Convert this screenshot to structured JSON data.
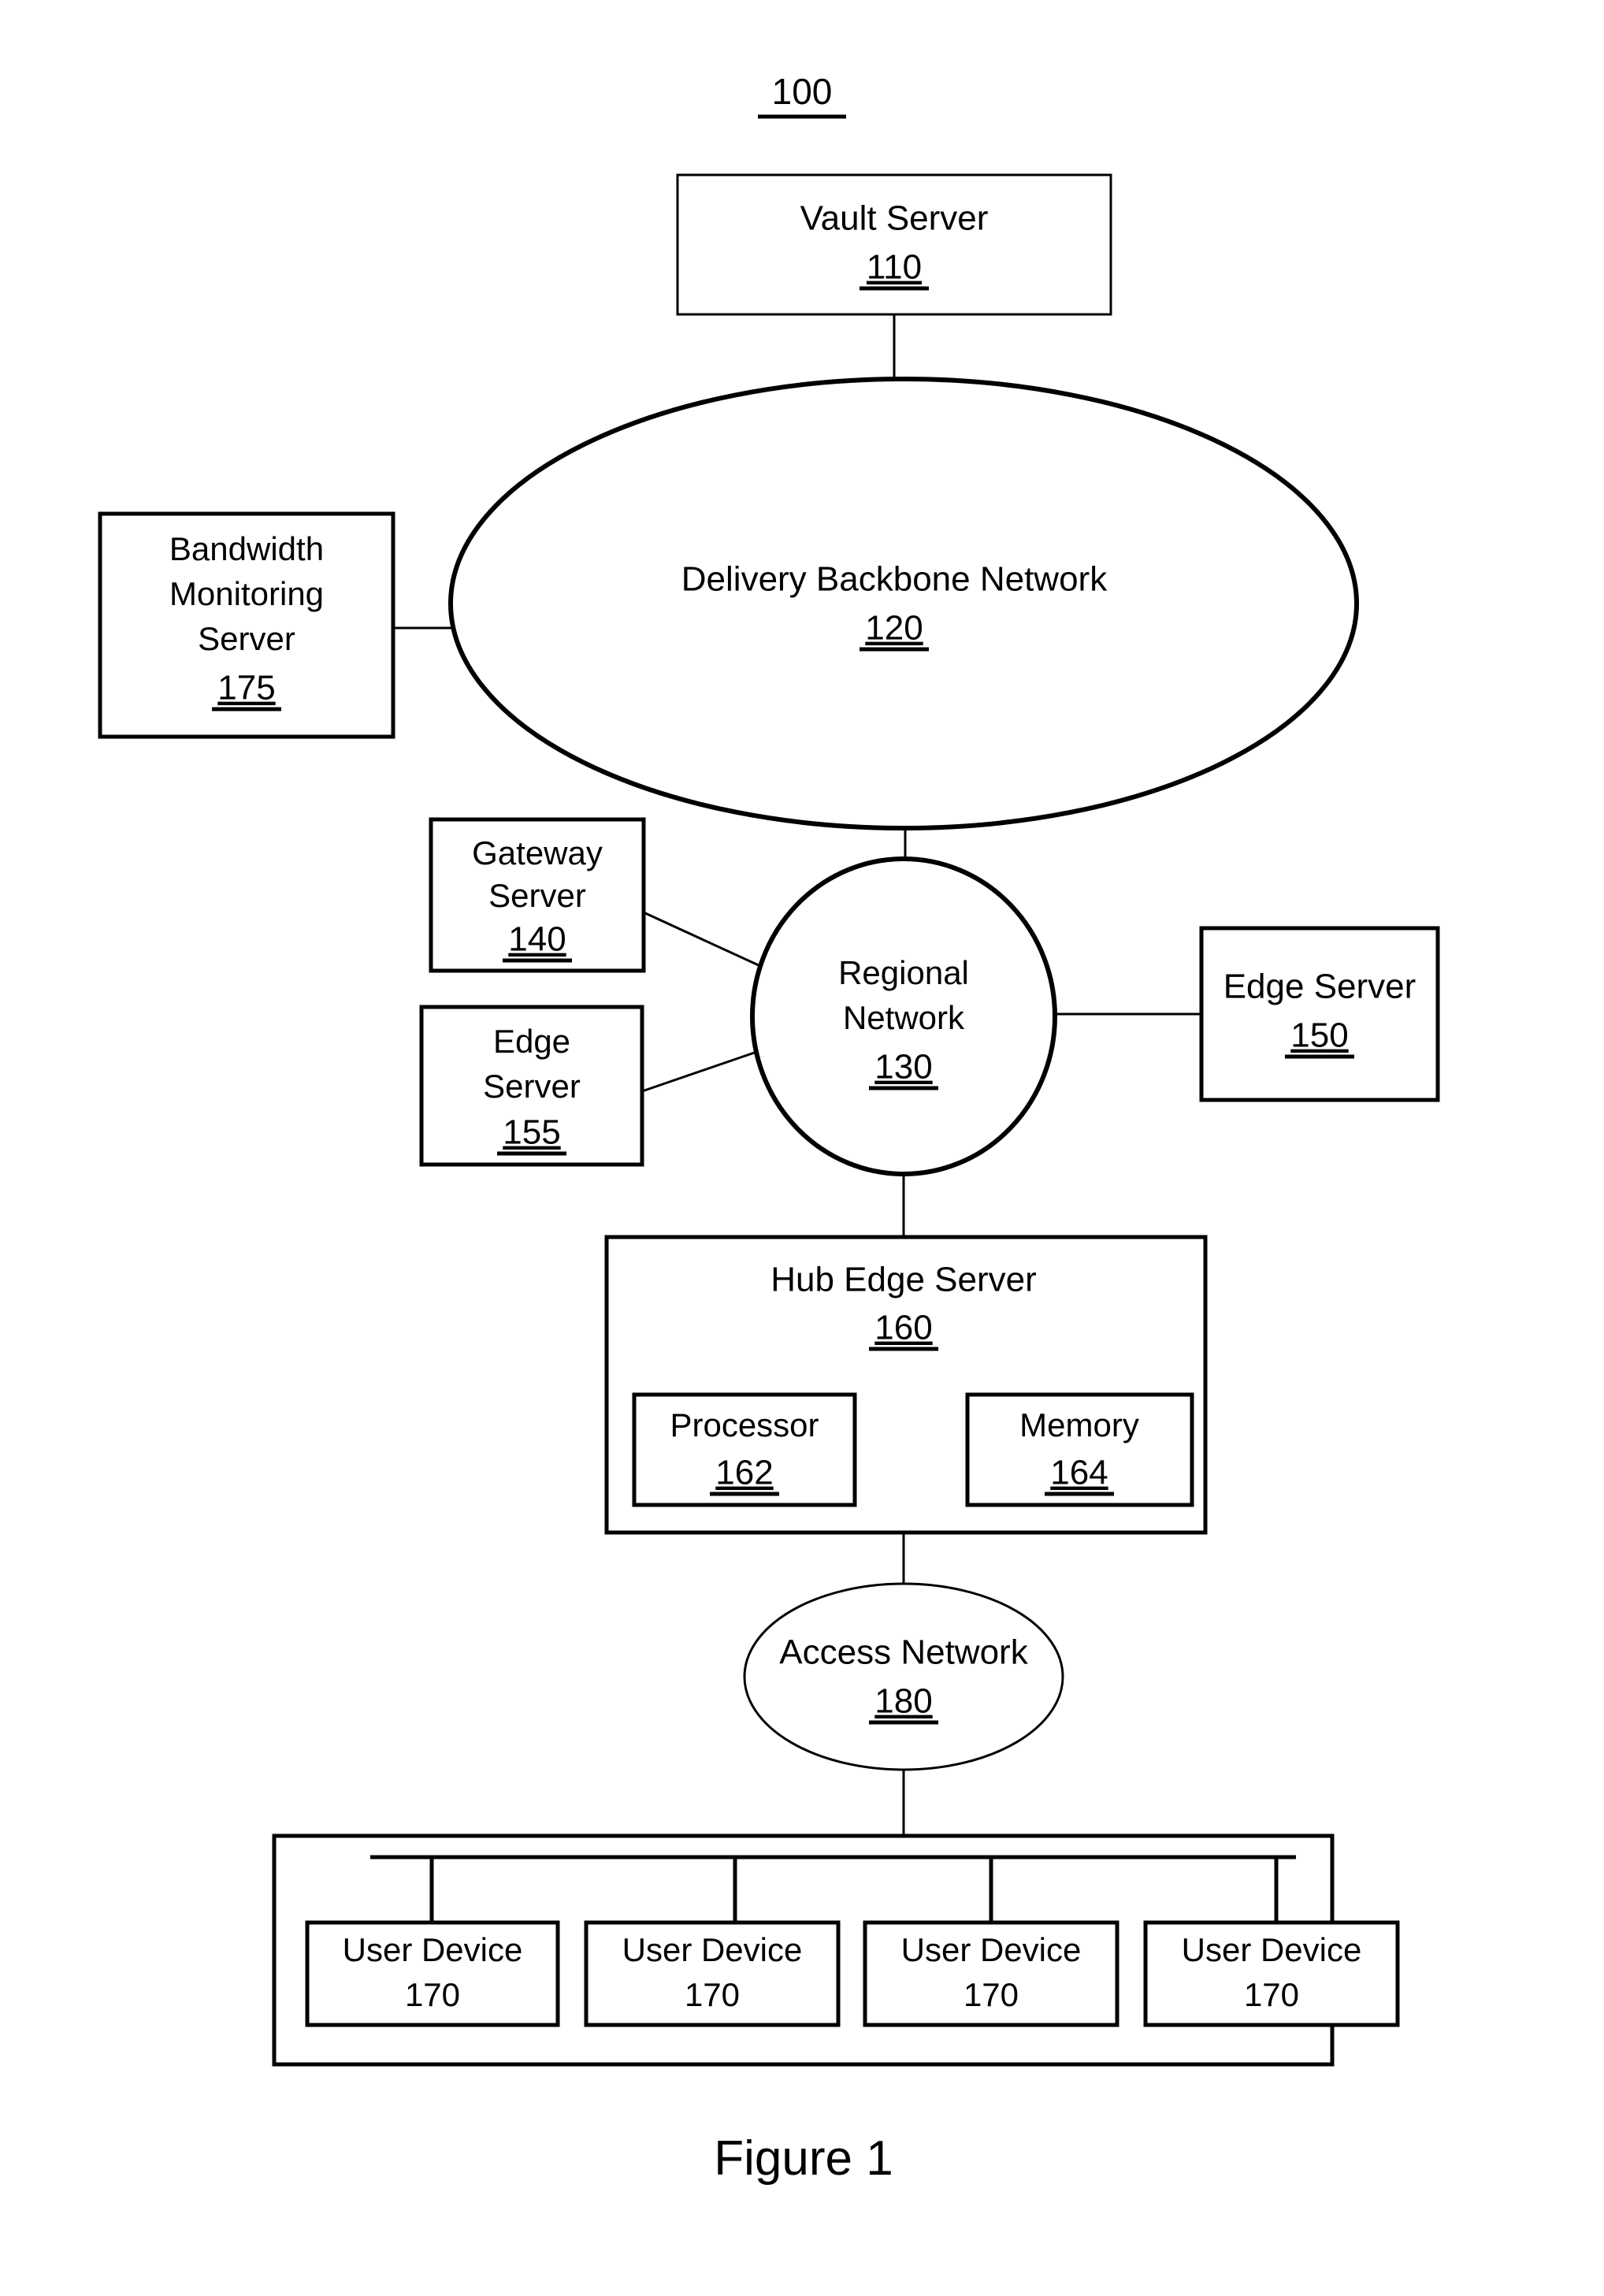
{
  "figure": {
    "system_ref": "100",
    "caption": "Figure 1"
  },
  "nodes": {
    "vault_server": {
      "label": "Vault Server",
      "ref": "110"
    },
    "backbone": {
      "label": "Delivery Backbone Network",
      "ref": "120"
    },
    "bandwidth": {
      "label_line1": "Bandwidth",
      "label_line2": "Monitoring",
      "label_line3": "Server",
      "ref": "175"
    },
    "gateway": {
      "label_line1": "Gateway",
      "label_line2": "Server",
      "ref": "140"
    },
    "edge_155": {
      "label_line1": "Edge",
      "label_line2": "Server",
      "ref": "155"
    },
    "regional": {
      "label_line1": "Regional",
      "label_line2": "Network",
      "ref": "130"
    },
    "edge_150": {
      "label": "Edge Server",
      "ref": "150"
    },
    "hub_edge": {
      "label": "Hub Edge Server",
      "ref": "160"
    },
    "processor": {
      "label": "Processor",
      "ref": "162"
    },
    "memory": {
      "label": "Memory",
      "ref": "164"
    },
    "access_network": {
      "label": "Access Network",
      "ref": "180"
    }
  },
  "user_devices": [
    {
      "label": "User Device",
      "ref": "170"
    },
    {
      "label": "User Device",
      "ref": "170"
    },
    {
      "label": "User Device",
      "ref": "170"
    },
    {
      "label": "User Device",
      "ref": "170"
    }
  ],
  "colors": {
    "ink": "#000000",
    "paper": "#ffffff"
  }
}
